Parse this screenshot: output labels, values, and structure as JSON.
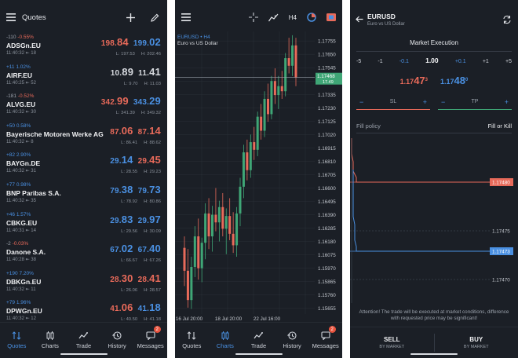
{
  "quotes_screen": {
    "title": "Quotes",
    "items": [
      {
        "change": "-110",
        "pct": "-0.55%",
        "dir": "neg",
        "symbol": "ADSGn.EU",
        "time": "11:40:32",
        "spread": "18",
        "bid_main": "198.",
        "bid_big": "84",
        "bid_dir": "dn",
        "ask_main": "199.",
        "ask_big": "02",
        "ask_dir": "up",
        "low": "L: 197.53",
        "high": "H: 202.46"
      },
      {
        "change": "+11",
        "pct": "1.02%",
        "dir": "pos",
        "symbol": "AIRF.EU",
        "time": "11:40:25",
        "spread": "52",
        "bid_main": "10.",
        "bid_big": "89",
        "bid_dir": "neutral",
        "ask_main": "11.",
        "ask_big": "41",
        "ask_dir": "neutral",
        "low": "L: 9.70",
        "high": "H: 11.03"
      },
      {
        "change": "-181",
        "pct": "-0.52%",
        "dir": "neg",
        "symbol": "ALVG.EU",
        "time": "11:40:32",
        "spread": "30",
        "bid_main": "342.",
        "bid_big": "99",
        "bid_dir": "dn",
        "ask_main": "343.",
        "ask_big": "29",
        "ask_dir": "up",
        "low": "L: 341.39",
        "high": "H: 349.32"
      },
      {
        "change": "+50",
        "pct": "0.58%",
        "dir": "pos",
        "symbol": "Bayerische Motoren Werke AG",
        "time": "11:40:32",
        "spread": "8",
        "bid_main": "87.",
        "bid_big": "06",
        "bid_dir": "dn",
        "ask_main": "87.",
        "ask_big": "14",
        "ask_dir": "dn",
        "low": "L: 86.41",
        "high": "H: 88.62"
      },
      {
        "change": "+82",
        "pct": "2.90%",
        "dir": "pos",
        "symbol": "BAYGn.DE",
        "time": "11:40:32",
        "spread": "31",
        "bid_main": "29.",
        "bid_big": "14",
        "bid_dir": "up",
        "ask_main": "29.",
        "ask_big": "45",
        "ask_dir": "dn",
        "low": "L: 28.55",
        "high": "H: 29.23"
      },
      {
        "change": "+77",
        "pct": "0.98%",
        "dir": "pos",
        "symbol": "BNP Paribas S.A.",
        "time": "11:40:32",
        "spread": "35",
        "bid_main": "79.",
        "bid_big": "38",
        "bid_dir": "up",
        "ask_main": "79.",
        "ask_big": "73",
        "ask_dir": "up",
        "low": "L: 78.92",
        "high": "H: 80.86"
      },
      {
        "change": "+46",
        "pct": "1.57%",
        "dir": "pos",
        "symbol": "CBKG.EU",
        "time": "11:40:31",
        "spread": "14",
        "bid_main": "29.",
        "bid_big": "83",
        "bid_dir": "up",
        "ask_main": "29.",
        "ask_big": "97",
        "ask_dir": "up",
        "low": "L: 29.56",
        "high": "H: 30.09"
      },
      {
        "change": "-2",
        "pct": "-0.03%",
        "dir": "neg",
        "symbol": "Danone S.A.",
        "time": "11:40:28",
        "spread": "38",
        "bid_main": "67.",
        "bid_big": "02",
        "bid_dir": "up",
        "ask_main": "67.",
        "ask_big": "40",
        "ask_dir": "up",
        "low": "L: 66.67",
        "high": "H: 67.26"
      },
      {
        "change": "+190",
        "pct": "7.20%",
        "dir": "pos",
        "symbol": "DBKGn.EU",
        "time": "11:40:32",
        "spread": "11",
        "bid_main": "28.",
        "bid_big": "30",
        "bid_dir": "dn",
        "ask_main": "28.",
        "ask_big": "41",
        "ask_dir": "dn",
        "low": "L: 26.06",
        "high": "H: 28.57"
      },
      {
        "change": "+79",
        "pct": "1.96%",
        "dir": "pos",
        "symbol": "DPWGn.EU",
        "time": "11:40:32",
        "spread": "12",
        "bid_main": "41.",
        "bid_big": "06",
        "bid_dir": "dn",
        "ask_main": "41.",
        "ask_big": "18",
        "ask_dir": "up",
        "low": "L: 40.50",
        "high": "H: 41.18"
      }
    ]
  },
  "nav": {
    "items": [
      {
        "label": "Quotes",
        "icon": "quotes-icon"
      },
      {
        "label": "Charts",
        "icon": "charts-icon"
      },
      {
        "label": "Trade",
        "icon": "trade-icon"
      },
      {
        "label": "History",
        "icon": "history-icon"
      },
      {
        "label": "Messages",
        "icon": "messages-icon",
        "badge": "2"
      }
    ],
    "badge": "2"
  },
  "chart_screen": {
    "timeframe": "H4",
    "symbol_label": "EURUSD • H4",
    "description": "Euro vs US Dollar",
    "current_price": "1.17468",
    "current_sub": "17.49",
    "colors": {
      "up": "#3fa676",
      "down": "#e86a5a",
      "grid": "#2a3038",
      "accent": "#4a90e2"
    }
  },
  "chart_data": {
    "type": "candlestick",
    "y_ticks": [
      "1.17755",
      "1.17650",
      "1.17545",
      "1.17440",
      "1.17335",
      "1.17230",
      "1.17125",
      "1.17020",
      "1.16915",
      "1.16810",
      "1.16705",
      "1.16600",
      "1.16495",
      "1.16390",
      "1.16285",
      "1.16180",
      "1.16075",
      "1.15970",
      "1.15865",
      "1.15760",
      "1.15655"
    ],
    "x_ticks": [
      "16 Jul 20:00",
      "18 Jul 20:00",
      "22 Jul 16:00"
    ],
    "ylim": [
      1.1561,
      1.1783
    ],
    "current_price": 1.17468,
    "candles": [
      {
        "o": 1.1613,
        "h": 1.1622,
        "l": 1.1583,
        "c": 1.1595
      },
      {
        "o": 1.1595,
        "h": 1.1612,
        "l": 1.1566,
        "c": 1.1572
      },
      {
        "o": 1.1572,
        "h": 1.1606,
        "l": 1.1565,
        "c": 1.1598
      },
      {
        "o": 1.1598,
        "h": 1.163,
        "l": 1.159,
        "c": 1.1622
      },
      {
        "o": 1.1622,
        "h": 1.1636,
        "l": 1.1588,
        "c": 1.1597
      },
      {
        "o": 1.1597,
        "h": 1.1621,
        "l": 1.1586,
        "c": 1.1617
      },
      {
        "o": 1.1617,
        "h": 1.1648,
        "l": 1.1604,
        "c": 1.164
      },
      {
        "o": 1.164,
        "h": 1.1652,
        "l": 1.1612,
        "c": 1.1622
      },
      {
        "o": 1.1622,
        "h": 1.1646,
        "l": 1.161,
        "c": 1.1639
      },
      {
        "o": 1.1639,
        "h": 1.166,
        "l": 1.1626,
        "c": 1.1633
      },
      {
        "o": 1.1633,
        "h": 1.165,
        "l": 1.1618,
        "c": 1.1645
      },
      {
        "o": 1.1645,
        "h": 1.1656,
        "l": 1.1622,
        "c": 1.1628
      },
      {
        "o": 1.1628,
        "h": 1.1644,
        "l": 1.1608,
        "c": 1.1638
      },
      {
        "o": 1.1638,
        "h": 1.1652,
        "l": 1.1619,
        "c": 1.1624
      },
      {
        "o": 1.1624,
        "h": 1.1641,
        "l": 1.1609,
        "c": 1.1615
      },
      {
        "o": 1.1615,
        "h": 1.1645,
        "l": 1.1606,
        "c": 1.164
      },
      {
        "o": 1.164,
        "h": 1.1668,
        "l": 1.163,
        "c": 1.1661
      },
      {
        "o": 1.1661,
        "h": 1.1694,
        "l": 1.1652,
        "c": 1.1688
      },
      {
        "o": 1.1688,
        "h": 1.1698,
        "l": 1.1666,
        "c": 1.1674
      },
      {
        "o": 1.1674,
        "h": 1.1702,
        "l": 1.1668,
        "c": 1.1696
      },
      {
        "o": 1.1696,
        "h": 1.1708,
        "l": 1.1682,
        "c": 1.169
      },
      {
        "o": 1.169,
        "h": 1.172,
        "l": 1.1685,
        "c": 1.1716
      },
      {
        "o": 1.1716,
        "h": 1.1726,
        "l": 1.1698,
        "c": 1.1705
      },
      {
        "o": 1.1705,
        "h": 1.1736,
        "l": 1.17,
        "c": 1.173
      },
      {
        "o": 1.173,
        "h": 1.1742,
        "l": 1.1712,
        "c": 1.1718
      },
      {
        "o": 1.1718,
        "h": 1.1748,
        "l": 1.1714,
        "c": 1.1744
      },
      {
        "o": 1.1744,
        "h": 1.1754,
        "l": 1.1726,
        "c": 1.1733
      },
      {
        "o": 1.1733,
        "h": 1.1748,
        "l": 1.1722,
        "c": 1.174
      },
      {
        "o": 1.174,
        "h": 1.1752,
        "l": 1.173,
        "c": 1.1736
      },
      {
        "o": 1.1736,
        "h": 1.1766,
        "l": 1.1732,
        "c": 1.1762
      },
      {
        "o": 1.1762,
        "h": 1.1778,
        "l": 1.175,
        "c": 1.1756
      },
      {
        "o": 1.1756,
        "h": 1.178,
        "l": 1.1748,
        "c": 1.1772
      },
      {
        "o": 1.1772,
        "h": 1.1778,
        "l": 1.174,
        "c": 1.1747
      }
    ]
  },
  "order_screen": {
    "symbol": "EURUSD",
    "description": "Euro vs US Dollar",
    "execution": "Market Execution",
    "volume_steps": [
      "-5",
      "-1",
      "-0.1",
      "1.00",
      "+0.1",
      "+1",
      "+5"
    ],
    "sell_price_main": "1.17",
    "sell_price_big": "47",
    "sell_price_sup": "3",
    "buy_price_main": "1.17",
    "buy_price_big": "48",
    "buy_price_sup": "0",
    "sl_label": "SL",
    "tp_label": "TP",
    "minus": "−",
    "plus": "+",
    "fill_label": "Fill policy",
    "fill_value": "Fill or Kill",
    "price_labels": [
      "1.17480",
      "1.17475",
      "1.17473",
      "1.17470"
    ],
    "warning": "Attention! The trade will be executed at market conditions, difference with requested price may be significant!",
    "sell": "SELL",
    "buy": "BUY",
    "by_market": "BY MARKET"
  }
}
